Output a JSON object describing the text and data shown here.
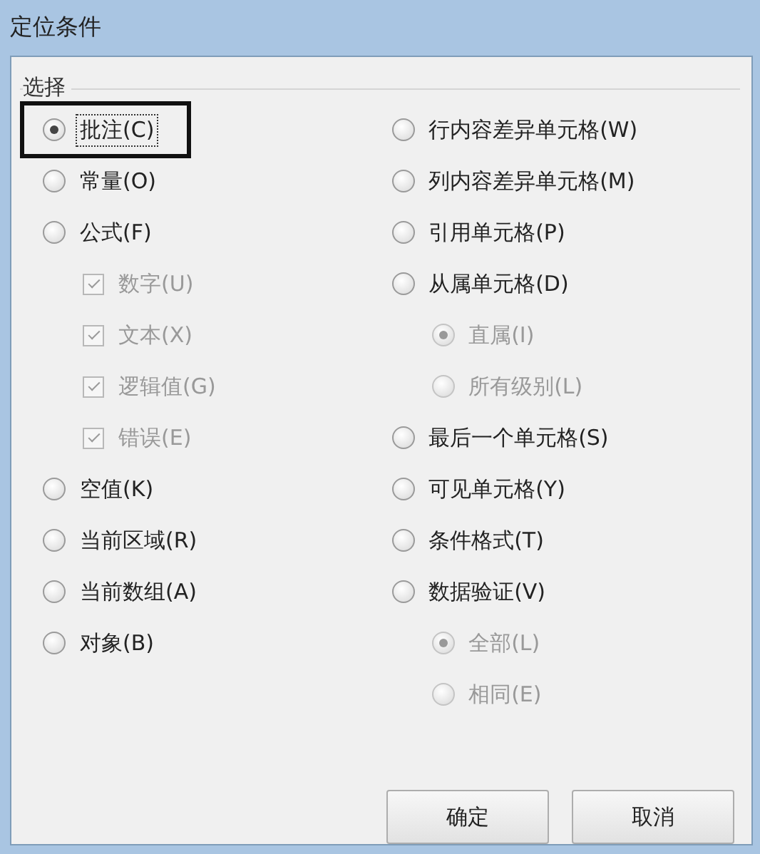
{
  "window": {
    "title": "定位条件"
  },
  "group": {
    "title": "选择"
  },
  "columns": [
    [
      {
        "label": "批注(C)",
        "kind": "radio",
        "selected": true,
        "disabled": false,
        "highlighted": true
      },
      {
        "label": "常量(O)",
        "kind": "radio",
        "selected": false,
        "disabled": false
      },
      {
        "label": "公式(F)",
        "kind": "radio",
        "selected": false,
        "disabled": false,
        "children": [
          {
            "label": "数字(U)",
            "kind": "checkbox",
            "checked": true,
            "disabled": true
          },
          {
            "label": "文本(X)",
            "kind": "checkbox",
            "checked": true,
            "disabled": true
          },
          {
            "label": "逻辑值(G)",
            "kind": "checkbox",
            "checked": true,
            "disabled": true
          },
          {
            "label": "错误(E)",
            "kind": "checkbox",
            "checked": true,
            "disabled": true
          }
        ]
      },
      {
        "label": "空值(K)",
        "kind": "radio",
        "selected": false,
        "disabled": false
      },
      {
        "label": "当前区域(R)",
        "kind": "radio",
        "selected": false,
        "disabled": false
      },
      {
        "label": "当前数组(A)",
        "kind": "radio",
        "selected": false,
        "disabled": false
      },
      {
        "label": "对象(B)",
        "kind": "radio",
        "selected": false,
        "disabled": false
      }
    ],
    [
      {
        "label": "行内容差异单元格(W)",
        "kind": "radio",
        "selected": false,
        "disabled": false
      },
      {
        "label": "列内容差异单元格(M)",
        "kind": "radio",
        "selected": false,
        "disabled": false
      },
      {
        "label": "引用单元格(P)",
        "kind": "radio",
        "selected": false,
        "disabled": false
      },
      {
        "label": "从属单元格(D)",
        "kind": "radio",
        "selected": false,
        "disabled": false,
        "children": [
          {
            "label": "直属(I)",
            "kind": "radio",
            "selected": true,
            "disabled": true
          },
          {
            "label": "所有级别(L)",
            "kind": "radio",
            "selected": false,
            "disabled": true
          }
        ]
      },
      {
        "label": "最后一个单元格(S)",
        "kind": "radio",
        "selected": false,
        "disabled": false
      },
      {
        "label": "可见单元格(Y)",
        "kind": "radio",
        "selected": false,
        "disabled": false
      },
      {
        "label": "条件格式(T)",
        "kind": "radio",
        "selected": false,
        "disabled": false
      },
      {
        "label": "数据验证(V)",
        "kind": "radio",
        "selected": false,
        "disabled": false,
        "children": [
          {
            "label": "全部(L)",
            "kind": "radio",
            "selected": true,
            "disabled": true
          },
          {
            "label": "相同(E)",
            "kind": "radio",
            "selected": false,
            "disabled": true
          }
        ]
      }
    ]
  ],
  "buttons": [
    "确定",
    "取消"
  ]
}
